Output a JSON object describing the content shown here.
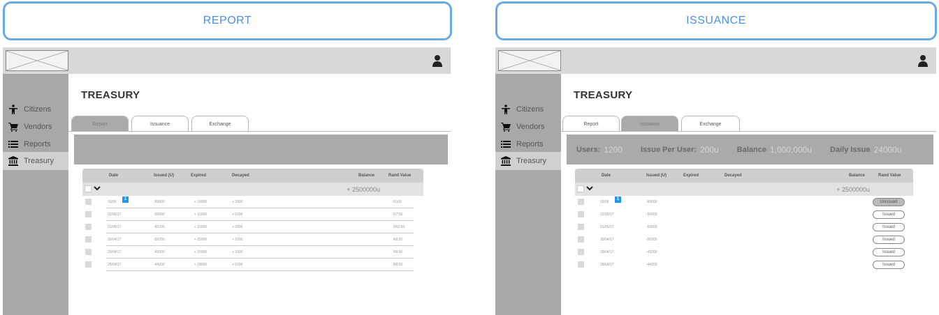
{
  "panels": [
    {
      "header": "REPORT",
      "page_title": "TREASURY",
      "sidebar": [
        {
          "label": "Citizens",
          "icon": "person-icon"
        },
        {
          "label": "Vendors",
          "icon": "cart-icon"
        },
        {
          "label": "Reports",
          "icon": "list-icon"
        },
        {
          "label": "Treasury",
          "icon": "bank-icon"
        }
      ],
      "active_sidebar": "Treasury",
      "tabs": [
        "Report",
        "Issuance",
        "Exchange"
      ],
      "active_tab": "Report",
      "table": {
        "columns": [
          "Date",
          "Issued (U)",
          "Expired",
          "Decayed",
          "Balance",
          "Rand Value"
        ],
        "balance": "+ 2500000u",
        "badge": "1",
        "rows": [
          {
            "date": "03/05",
            "issued": "-80000",
            "expired": "+ 18000",
            "decayed": "+ 2000",
            "rand": "R100"
          },
          {
            "date": "02/05/17",
            "issued": "-50000",
            "expired": "+ 15000",
            "decayed": "+ 1000",
            "rand": "R7.50"
          },
          {
            "date": "01/05/17",
            "issued": "-80200",
            "expired": "+ 15000",
            "decayed": "+ 2000",
            "rand": "R62.50"
          },
          {
            "date": "30/04/17",
            "issued": "-50200",
            "expired": "+ 25000",
            "decayed": "+ 1000",
            "rand": "R8.50"
          },
          {
            "date": "29/04/17",
            "issued": "-49200",
            "expired": "+ 15000",
            "decayed": "+ 1000",
            "rand": "R8.50"
          },
          {
            "date": "28/04/17",
            "issued": "-44200",
            "expired": "+ 18000",
            "decayed": "+ 1000",
            "rand": "R8.50"
          }
        ]
      }
    },
    {
      "header": "ISSUANCE",
      "page_title": "TREASURY",
      "sidebar": [
        {
          "label": "Citizens",
          "icon": "person-icon"
        },
        {
          "label": "Vendors",
          "icon": "cart-icon"
        },
        {
          "label": "Reports",
          "icon": "list-icon"
        },
        {
          "label": "Treasury",
          "icon": "bank-icon"
        }
      ],
      "active_sidebar": "Treasury",
      "tabs": [
        "Report",
        "Issuance",
        "Exchange"
      ],
      "active_tab": "Issuance",
      "stats": [
        {
          "label": "Users:",
          "value": "1200"
        },
        {
          "label": "Issue Per User:",
          "value": "200u"
        },
        {
          "label": "Balance",
          "value": "1,000,000u"
        },
        {
          "label": "Daily Issue",
          "value": "24000u"
        }
      ],
      "table": {
        "columns": [
          "Date",
          "Issued (U)",
          "Expired",
          "Decayed",
          "Balance",
          "Rand Value"
        ],
        "balance": "+ 2500000u",
        "badge": "1",
        "rows": [
          {
            "date": "03/05",
            "issued": "-80000",
            "status": "Unissued"
          },
          {
            "date": "02/05/17",
            "issued": "-50000",
            "status": "Issued"
          },
          {
            "date": "01/05/17",
            "issued": "-50000",
            "status": "Issued"
          },
          {
            "date": "30/04/17",
            "issued": "-50200",
            "status": "Issued"
          },
          {
            "date": "29/04/17",
            "issued": "-49200",
            "status": "Issued"
          },
          {
            "date": "28/04/17",
            "issued": "-44200",
            "status": "Issued"
          }
        ]
      }
    }
  ]
}
